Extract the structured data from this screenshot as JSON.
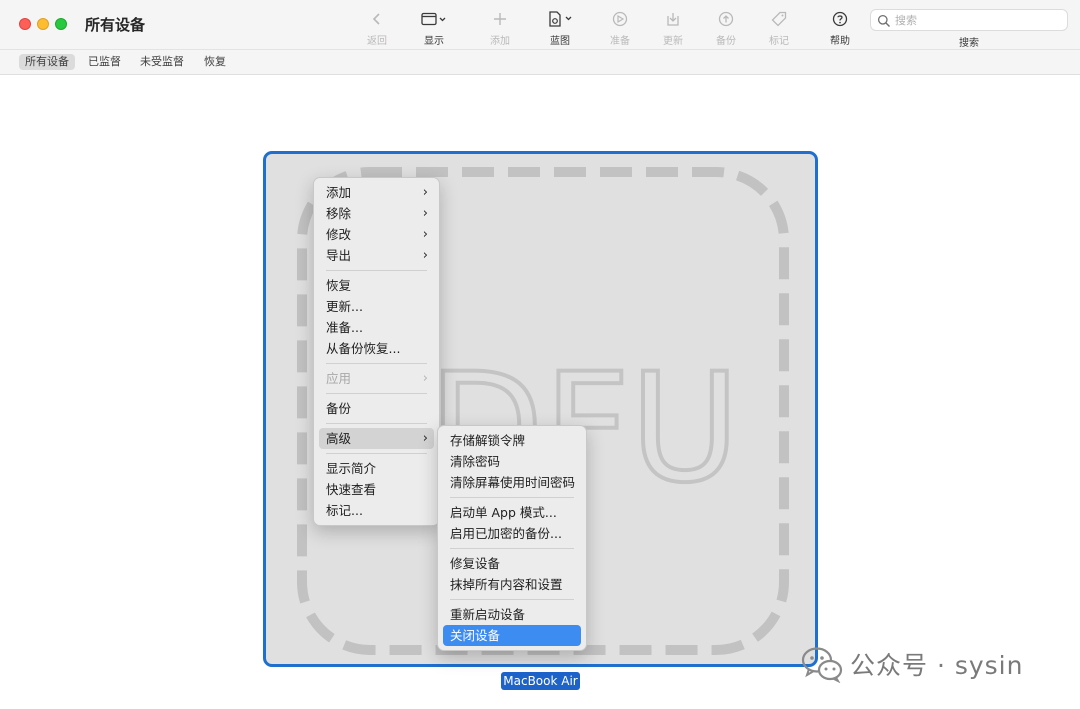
{
  "window": {
    "title": "所有设备"
  },
  "toolbar": {
    "back": {
      "label": "返回",
      "icon": "chevron-left-icon"
    },
    "view": {
      "label": "显示",
      "icon": "window-view-icon"
    },
    "add": {
      "label": "添加",
      "icon": "plus-icon"
    },
    "blueprint": {
      "label": "蓝图",
      "icon": "blueprint-doc-icon"
    },
    "prepare": {
      "label": "准备",
      "icon": "prepare-gauge-icon"
    },
    "update": {
      "label": "更新",
      "icon": "update-tray-icon"
    },
    "backup": {
      "label": "备份",
      "icon": "backup-circle-icon"
    },
    "tag": {
      "label": "标记",
      "icon": "tag-icon"
    },
    "help": {
      "label": "帮助",
      "icon": "help-circle-icon"
    },
    "search": {
      "placeholder": "搜索",
      "label": "搜索",
      "icon": "search-icon"
    }
  },
  "scopes": [
    "所有设备",
    "已监督",
    "未受监督",
    "恢复"
  ],
  "device": {
    "name": "MacBook Air",
    "mode_art": "DFU"
  },
  "context_menu": {
    "items": [
      {
        "label": "添加"
      },
      {
        "label": "移除"
      },
      {
        "label": "修改"
      },
      {
        "label": "导出"
      },
      {
        "label": "恢复"
      },
      {
        "label": "更新..."
      },
      {
        "label": "准备..."
      },
      {
        "label": "从备份恢复..."
      },
      {
        "label": "应用"
      },
      {
        "label": "备份"
      },
      {
        "label": "高级"
      },
      {
        "label": "显示简介"
      },
      {
        "label": "快速查看"
      },
      {
        "label": "标记..."
      }
    ]
  },
  "submenu": {
    "items": [
      {
        "label": "存储解锁令牌"
      },
      {
        "label": "清除密码"
      },
      {
        "label": "清除屏幕使用时间密码"
      },
      {
        "label": "启动单 App 模式..."
      },
      {
        "label": "启用已加密的备份..."
      },
      {
        "label": "修复设备"
      },
      {
        "label": "抹掉所有内容和设置"
      },
      {
        "label": "重新启动设备"
      },
      {
        "label": "关闭设备"
      }
    ]
  },
  "watermark": {
    "text": "公众号 · sysin"
  },
  "colors": {
    "accent": "#1f6fce",
    "selection": "#3d8cf2"
  }
}
